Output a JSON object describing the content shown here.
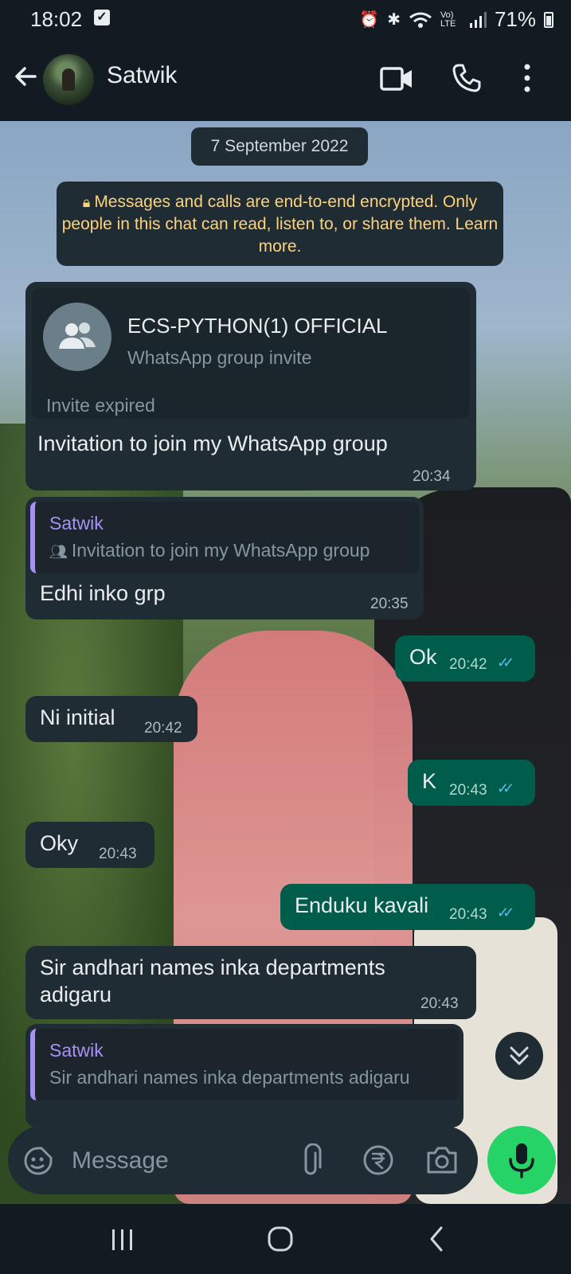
{
  "status_bar": {
    "time": "18:02",
    "battery": "71%",
    "network": "Vo) LTE"
  },
  "header": {
    "contact_name": "Satwik",
    "icons": [
      "back-arrow-icon",
      "video-call-icon",
      "voice-call-icon",
      "more-vert-icon"
    ]
  },
  "chat": {
    "date_chip": "7 September 2022",
    "encryption_notice": "Messages and calls are end-to-end encrypted. Only people in this chat can read, listen to, or share them. Learn more.",
    "messages": [
      {
        "direction": "in",
        "type": "group_invite",
        "group_name": "ECS-PYTHON(1) OFFICIAL",
        "group_subtitle": "WhatsApp group invite",
        "invite_status": "Invite expired",
        "text": "Invitation to join my WhatsApp group",
        "time": "20:34"
      },
      {
        "direction": "in",
        "type": "reply",
        "quoted_author": "Satwik",
        "quoted_text": "Invitation to join my WhatsApp group",
        "text": "Edhi inko grp",
        "time": "20:35"
      },
      {
        "direction": "out",
        "text": "Ok",
        "time": "20:42",
        "status": "read"
      },
      {
        "direction": "in",
        "text": "Ni initial",
        "time": "20:42"
      },
      {
        "direction": "out",
        "text": "K",
        "time": "20:43",
        "status": "read"
      },
      {
        "direction": "in",
        "text": "Oky",
        "time": "20:43"
      },
      {
        "direction": "out",
        "text": "Enduku kavali",
        "time": "20:43",
        "status": "read"
      },
      {
        "direction": "in",
        "text_line1": "Sir andhari names inka departments",
        "text_line2": "adigaru",
        "time": "20:43"
      },
      {
        "direction": "in",
        "type": "reply",
        "quoted_author": "Satwik",
        "quoted_text": "Sir andhari names inka departments adigaru"
      }
    ]
  },
  "composer": {
    "placeholder": "Message",
    "icons": [
      "emoji-sticker-icon",
      "attach-icon",
      "payment-rupee-icon",
      "camera-icon",
      "mic-icon"
    ]
  },
  "colors": {
    "incoming_bubble": "#202c33",
    "outgoing_bubble": "#005c4b",
    "read_ticks": "#53bdeb",
    "accent_green": "#25d366",
    "quote_author": "#a791f7",
    "encryption_text": "#ffd279"
  }
}
